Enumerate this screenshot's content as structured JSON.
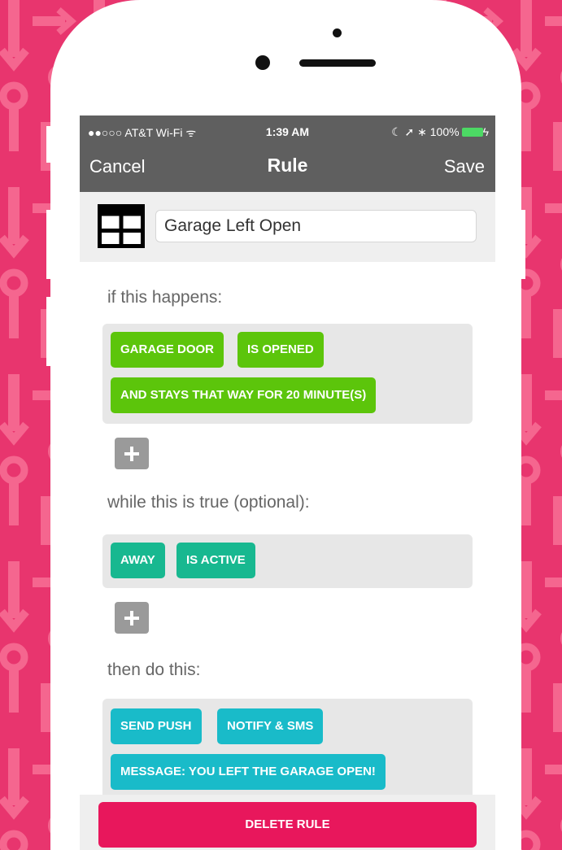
{
  "colors": {
    "background_pink": "#e8356e",
    "pattern_pink": "#f5668f",
    "navbar_gray": "#5f5f5f",
    "trigger_green": "#5cc50b",
    "condition_teal": "#18b890",
    "action_cyan": "#19bbc9",
    "delete_red": "#e8175c",
    "add_button_gray": "#9a9a9a"
  },
  "status_bar": {
    "carrier": "●●○○○ AT&T Wi-Fi ᯤ",
    "time": "1:39 AM",
    "right": "☾ ➚ ∗ 100%",
    "battery_charging": "ϟ"
  },
  "navbar": {
    "cancel_label": "Cancel",
    "title": "Rule",
    "save_label": "Save"
  },
  "rule_name": {
    "icon": "grid-icon",
    "value": "Garage Left Open",
    "placeholder": ""
  },
  "sections": {
    "trigger": {
      "label": "if this happens:",
      "chips": [
        "GARAGE DOOR",
        "IS OPENED",
        "AND STAYS THAT WAY FOR 20 MINUTE(S)"
      ]
    },
    "condition": {
      "label": "while this is true (optional):",
      "chips": [
        "AWAY",
        "IS ACTIVE"
      ]
    },
    "action": {
      "label": "then do this:",
      "chips": [
        "SEND PUSH",
        "NOTIFY & SMS",
        "MESSAGE: YOU LEFT THE GARAGE OPEN!"
      ]
    }
  },
  "add_button": {
    "icon": "plus-icon"
  },
  "footer": {
    "delete_label": "DELETE RULE"
  }
}
